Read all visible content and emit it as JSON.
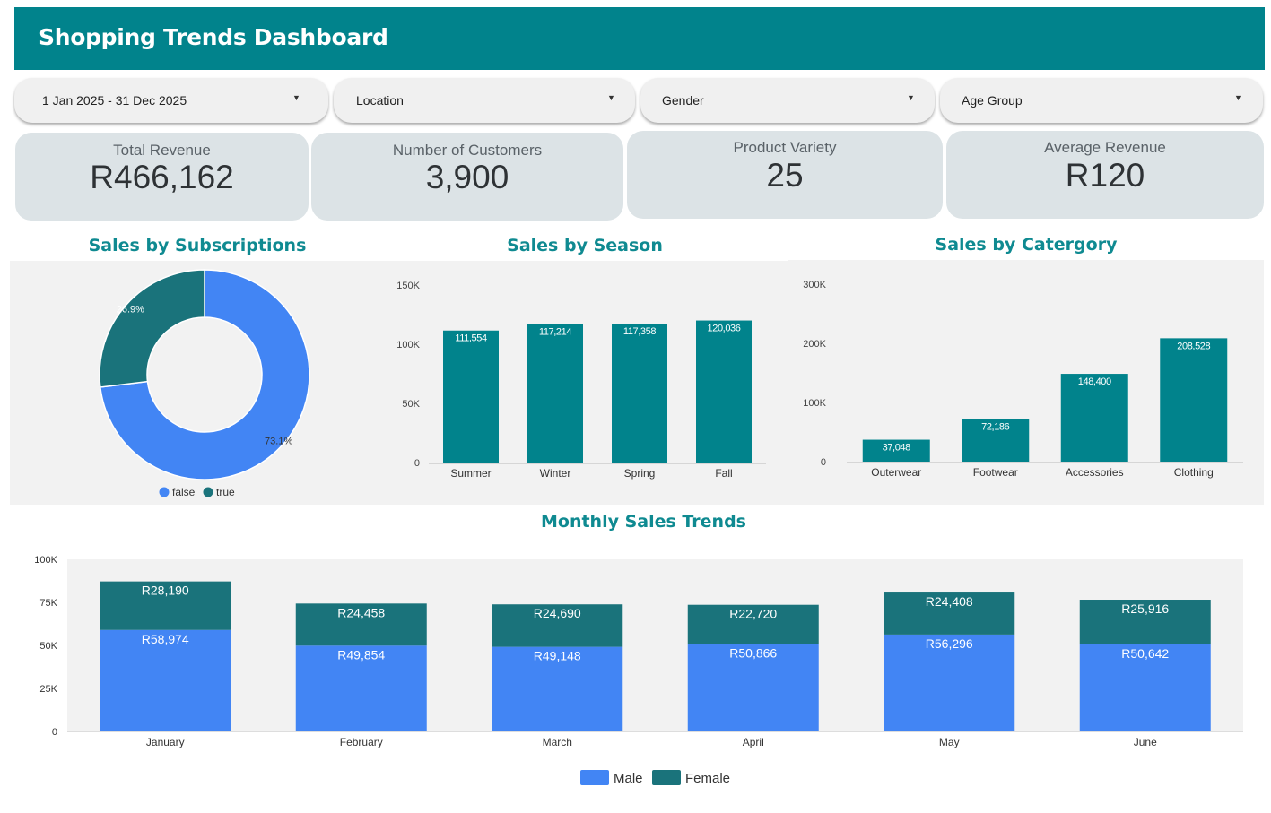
{
  "header": {
    "title": "Shopping Trends Dashboard"
  },
  "filters": [
    {
      "label": "1 Jan 2025 - 31 Dec 2025"
    },
    {
      "label": "Location"
    },
    {
      "label": "Gender"
    },
    {
      "label": "Age Group"
    }
  ],
  "kpis": [
    {
      "title": "Total Revenue",
      "value": "R466,162"
    },
    {
      "title": "Number of Customers",
      "value": "3,900"
    },
    {
      "title": "Product Variety",
      "value": "25"
    },
    {
      "title": "Average Revenue",
      "value": "R120"
    }
  ],
  "sections": {
    "subscriptions": "Sales by Subscriptions",
    "season": "Sales by Season",
    "category": "Sales by Catergory",
    "monthly": "Monthly Sales Trends"
  },
  "colors": {
    "header": "#01838c",
    "teal": "#01838c",
    "blue": "#4285f4",
    "dark_teal": "#1a737b"
  },
  "chart_data": [
    {
      "type": "pie",
      "title": "Sales by Subscriptions",
      "categories": [
        "false",
        "true"
      ],
      "values": [
        73.1,
        26.9
      ],
      "labels": [
        "73.1%",
        "26.9%"
      ],
      "colors": [
        "#4285f4",
        "#1a737b"
      ],
      "legend": "bottom"
    },
    {
      "type": "bar",
      "title": "Sales by Season",
      "categories": [
        "Summer",
        "Winter",
        "Spring",
        "Fall"
      ],
      "values": [
        111554,
        117214,
        117358,
        120036
      ],
      "value_labels": [
        "111,554",
        "117,214",
        "117,358",
        "120,036"
      ],
      "yticks": [
        "0",
        "50K",
        "100K",
        "150K"
      ],
      "ylim": [
        0,
        150000
      ]
    },
    {
      "type": "bar",
      "title": "Sales by Catergory",
      "categories": [
        "Outerwear",
        "Footwear",
        "Accessories",
        "Clothing"
      ],
      "values": [
        37048,
        72186,
        148400,
        208528
      ],
      "value_labels": [
        "37,048",
        "72,186",
        "148,400",
        "208,528"
      ],
      "yticks": [
        "0",
        "100K",
        "200K",
        "300K"
      ],
      "ylim": [
        0,
        300000
      ]
    },
    {
      "type": "bar",
      "title": "Monthly Sales Trends",
      "stacked": true,
      "categories": [
        "January",
        "February",
        "March",
        "April",
        "May",
        "June"
      ],
      "series": [
        {
          "name": "Male",
          "values": [
            58974,
            49854,
            49148,
            50866,
            56296,
            50642
          ],
          "value_labels": [
            "R58,974",
            "R49,854",
            "R49,148",
            "R50,866",
            "R56,296",
            "R50,642"
          ]
        },
        {
          "name": "Female",
          "values": [
            28190,
            24458,
            24690,
            22720,
            24408,
            25916
          ],
          "value_labels": [
            "R28,190",
            "R24,458",
            "R24,690",
            "R22,720",
            "R24,408",
            "R25,916"
          ]
        }
      ],
      "yticks": [
        "0",
        "25K",
        "50K",
        "75K",
        "100K"
      ],
      "ylim": [
        0,
        100000
      ],
      "legend": "bottom"
    }
  ]
}
